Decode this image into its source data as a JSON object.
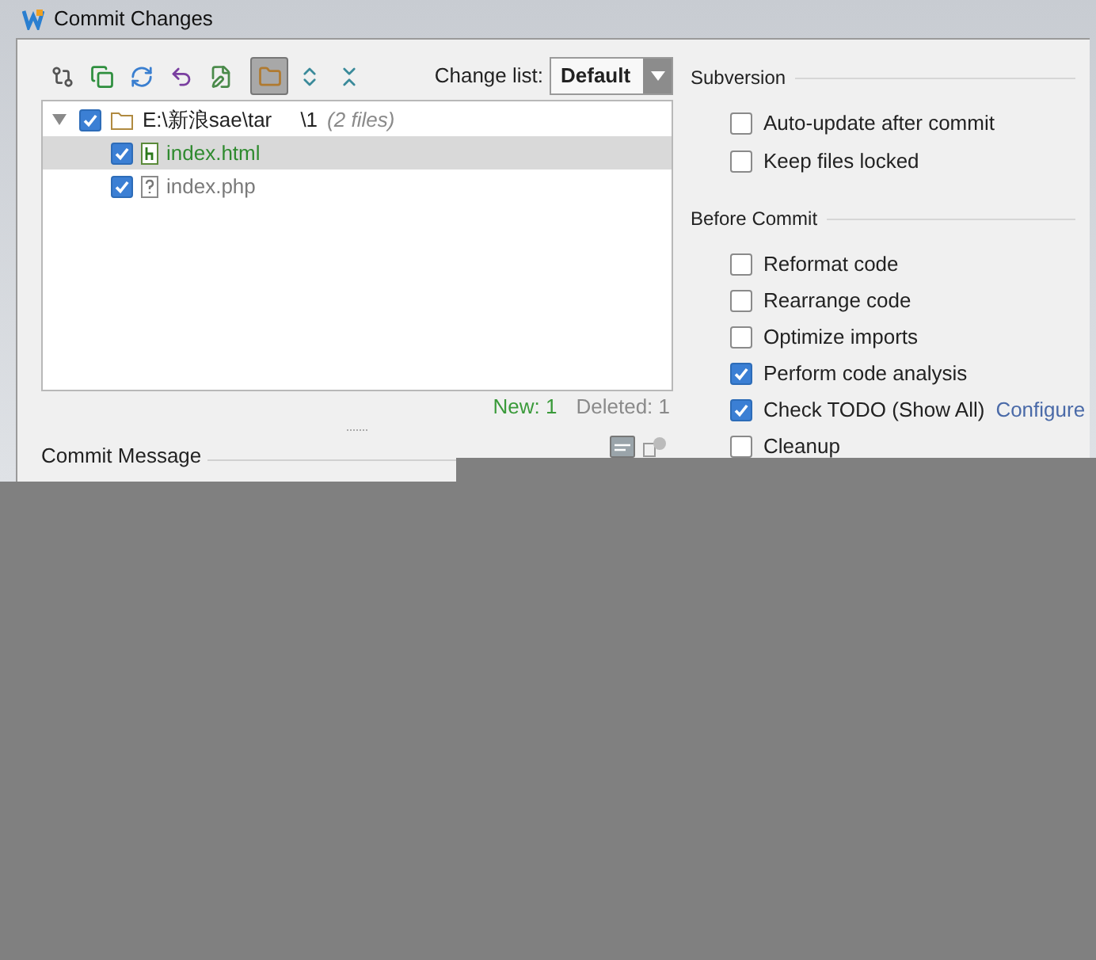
{
  "window": {
    "title": "Commit Changes"
  },
  "toolbar": [
    {
      "kind": "compare",
      "selected": false
    },
    {
      "kind": "copy",
      "selected": false
    },
    {
      "kind": "refresh",
      "selected": false
    },
    {
      "kind": "undo",
      "selected": false
    },
    {
      "kind": "edit",
      "selected": false
    },
    {
      "kind": "group",
      "selected": true
    },
    {
      "kind": "expand",
      "selected": false
    },
    {
      "kind": "collapse",
      "selected": false
    }
  ],
  "change_list": {
    "label": "Change list:",
    "value": "Default"
  },
  "tree": {
    "label": "E:\\新浪sae\\tar     \\1",
    "note": "(2 files)",
    "checked": true,
    "expanded": true,
    "children": [
      {
        "name": "index.html",
        "kind": "new",
        "checked": true,
        "selected": true
      },
      {
        "name": "index.php",
        "kind": "unversioned",
        "checked": true,
        "selected": false
      }
    ]
  },
  "summary": [
    {
      "kind": "new",
      "text": "New: 1"
    },
    {
      "kind": "deleted",
      "text": "Deleted: 1"
    }
  ],
  "commit_message": {
    "label": "Commit Message"
  },
  "sections": [
    {
      "title": "Subversion",
      "options": [
        {
          "label": "Auto-update after commit",
          "checked": false
        },
        {
          "label": "Keep files locked",
          "checked": false
        }
      ]
    },
    {
      "title": "Before Commit",
      "options": [
        {
          "label": "Reformat code",
          "checked": false
        },
        {
          "label": "Rearrange code",
          "checked": false
        },
        {
          "label": "Optimize imports",
          "checked": false
        },
        {
          "label": "Perform code analysis",
          "checked": true
        },
        {
          "label": "Check TODO (Show All)",
          "checked": true,
          "link": "Configure"
        },
        {
          "label": "Cleanup",
          "checked": false
        }
      ]
    }
  ]
}
